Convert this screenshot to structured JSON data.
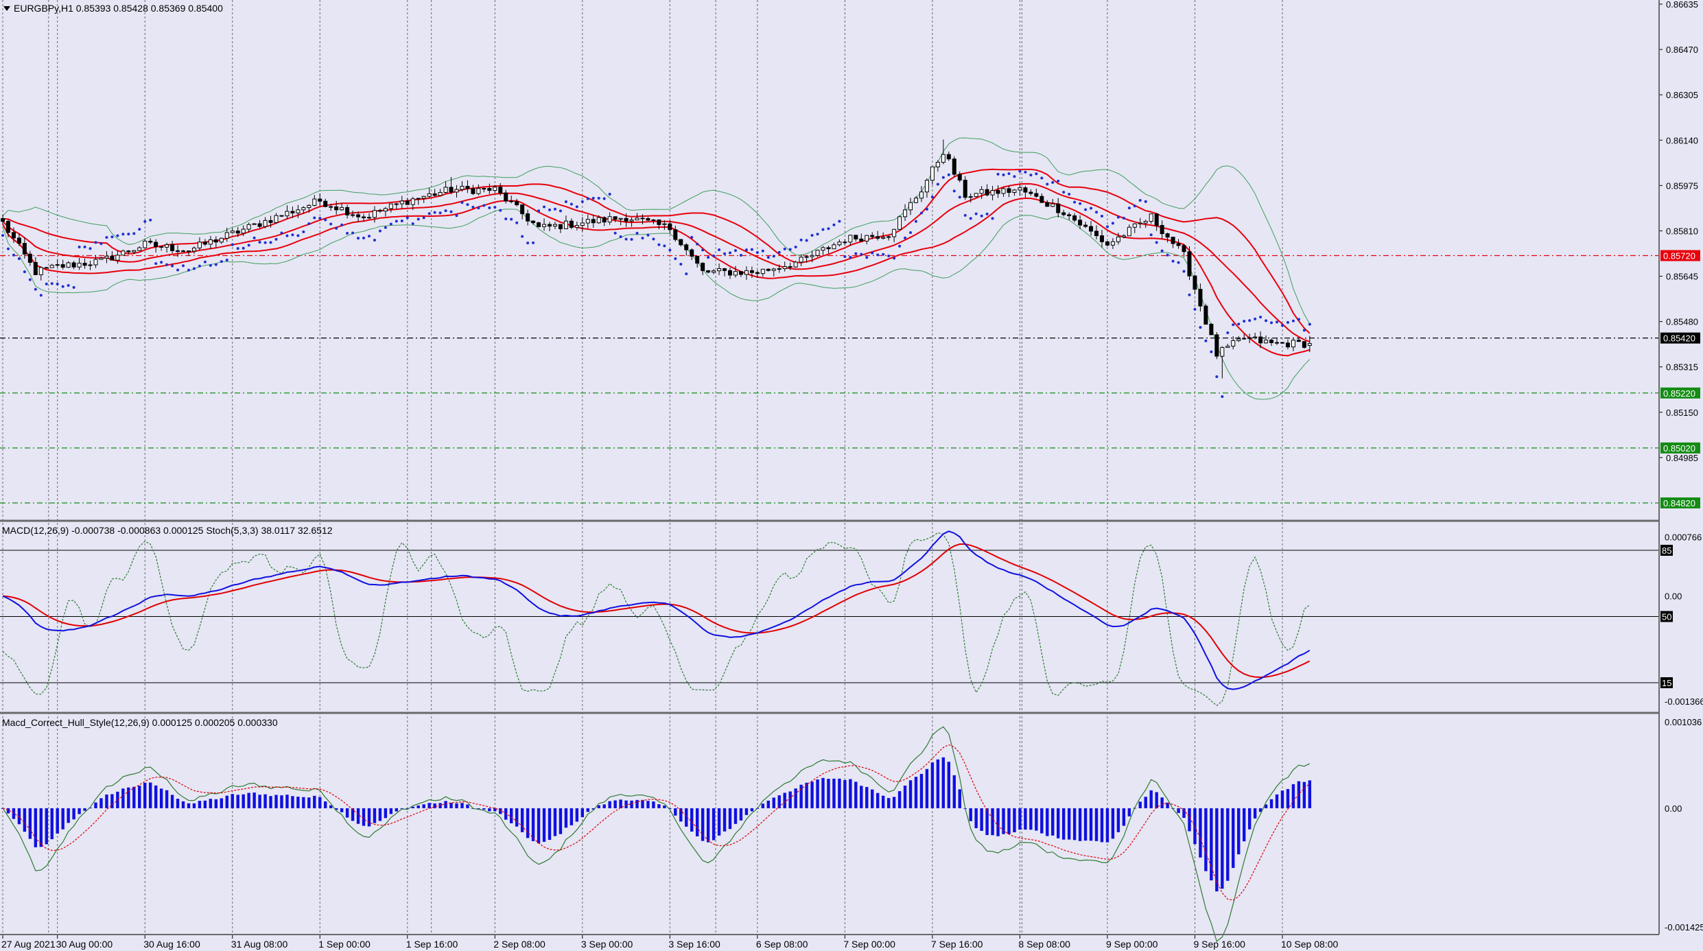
{
  "symbol_header": "EURGBPy,H1  0.85393 0.85428 0.85369 0.85400",
  "macd_header": "MACD(12,26,9) -0.000738 -0.000863 0.000125  Stoch(5,3,3) 38.0117 32.6512",
  "hull_header": "Macd_Correct_Hull_Style(12,26,9) 0.000125 0.000205 0.000330",
  "colors": {
    "background": "#e6e6f5",
    "candle": "#000000",
    "ma": "#e8000b",
    "bollinger": "#3f9f5a",
    "psar": "#1f2fd0",
    "macd_line": "#1010e0",
    "signal_line": "#e00000",
    "stoch": "#2e7a2e",
    "histogram": "#1010e0",
    "hull_line": "#2e7a2e",
    "hull_signal": "#e00000",
    "level_red": "#e8000b",
    "level_green": "#148c14",
    "current_price": "#000000"
  },
  "x_labels": [
    {
      "label": "27 Aug 2021",
      "bar": 0
    },
    {
      "label": "30 Aug 00:00",
      "bar": 10
    },
    {
      "label": "30 Aug 16:00",
      "bar": 26
    },
    {
      "label": "31 Aug 08:00",
      "bar": 42
    },
    {
      "label": "1 Sep 00:00",
      "bar": 58
    },
    {
      "label": "1 Sep 16:00",
      "bar": 74
    },
    {
      "label": "2 Sep 08:00",
      "bar": 90
    },
    {
      "label": "3 Sep 00:00",
      "bar": 106
    },
    {
      "label": "3 Sep 16:00",
      "bar": 122
    },
    {
      "label": "6 Sep 08:00",
      "bar": 138
    },
    {
      "label": "7 Sep 00:00",
      "bar": 154
    },
    {
      "label": "7 Sep 16:00",
      "bar": 170
    },
    {
      "label": "8 Sep 08:00",
      "bar": 186
    },
    {
      "label": "9 Sep 00:00",
      "bar": 202
    },
    {
      "label": "9 Sep 16:00",
      "bar": 218
    },
    {
      "label": "10 Sep 08:00",
      "bar": 234
    }
  ],
  "price_labels": [
    "0.86635",
    "0.86470",
    "0.86305",
    "0.86140",
    "0.85975",
    "0.85810",
    "0.85645",
    "0.85480",
    "0.85315",
    "0.85150",
    "0.84985"
  ],
  "levels": [
    {
      "price": 0.8572,
      "label": "0.85720",
      "type": "red"
    },
    {
      "price": 0.8542,
      "label": "0.85420",
      "type": "current"
    },
    {
      "price": 0.8522,
      "label": "0.85220",
      "type": "green"
    },
    {
      "price": 0.8502,
      "label": "0.85020",
      "type": "green"
    },
    {
      "price": 0.8482,
      "label": "0.84820",
      "type": "green"
    }
  ],
  "macd_labels": [
    {
      "text": "0.000766",
      "value": 0.000766
    },
    {
      "text": "0.00",
      "value": 0.0
    },
    {
      "text": "-0.001366",
      "value": -0.001366
    }
  ],
  "stoch_levels": [
    {
      "text": "85",
      "value": 85
    },
    {
      "text": "50",
      "value": 50
    },
    {
      "text": "15",
      "value": 15
    }
  ],
  "hull_labels": [
    {
      "text": "0.001036",
      "value": 0.001036
    },
    {
      "text": "0.00",
      "value": 0.0
    },
    {
      "text": "-0.001425",
      "value": -0.001425
    }
  ],
  "chart_data": {
    "type": "candlestick",
    "symbol": "EURGBPy",
    "timeframe": "H1",
    "bar_count": 240,
    "y_range": [
      0.8476,
      0.8665
    ],
    "last_ohlc": {
      "open": 0.85393,
      "high": 0.85428,
      "low": 0.85369,
      "close": 0.854
    },
    "close_anchors": [
      {
        "bar": 0,
        "close": 0.8584
      },
      {
        "bar": 6,
        "close": 0.8566
      },
      {
        "bar": 10,
        "close": 0.8568
      },
      {
        "bar": 18,
        "close": 0.857
      },
      {
        "bar": 26,
        "close": 0.8576
      },
      {
        "bar": 34,
        "close": 0.8574
      },
      {
        "bar": 42,
        "close": 0.858
      },
      {
        "bar": 50,
        "close": 0.8586
      },
      {
        "bar": 58,
        "close": 0.8592
      },
      {
        "bar": 66,
        "close": 0.8586
      },
      {
        "bar": 74,
        "close": 0.8592
      },
      {
        "bar": 82,
        "close": 0.8596
      },
      {
        "bar": 90,
        "close": 0.8596
      },
      {
        "bar": 98,
        "close": 0.8582
      },
      {
        "bar": 106,
        "close": 0.8584
      },
      {
        "bar": 114,
        "close": 0.8586
      },
      {
        "bar": 122,
        "close": 0.8582
      },
      {
        "bar": 128,
        "close": 0.8566
      },
      {
        "bar": 138,
        "close": 0.8566
      },
      {
        "bar": 146,
        "close": 0.857
      },
      {
        "bar": 154,
        "close": 0.8578
      },
      {
        "bar": 162,
        "close": 0.858
      },
      {
        "bar": 168,
        "close": 0.8596
      },
      {
        "bar": 172,
        "close": 0.861
      },
      {
        "bar": 176,
        "close": 0.8594
      },
      {
        "bar": 186,
        "close": 0.8596
      },
      {
        "bar": 194,
        "close": 0.8588
      },
      {
        "bar": 202,
        "close": 0.8576
      },
      {
        "bar": 210,
        "close": 0.8586
      },
      {
        "bar": 216,
        "close": 0.8572
      },
      {
        "bar": 222,
        "close": 0.8536
      },
      {
        "bar": 227,
        "close": 0.8542
      },
      {
        "bar": 232,
        "close": 0.854
      },
      {
        "bar": 239,
        "close": 0.854
      }
    ]
  }
}
